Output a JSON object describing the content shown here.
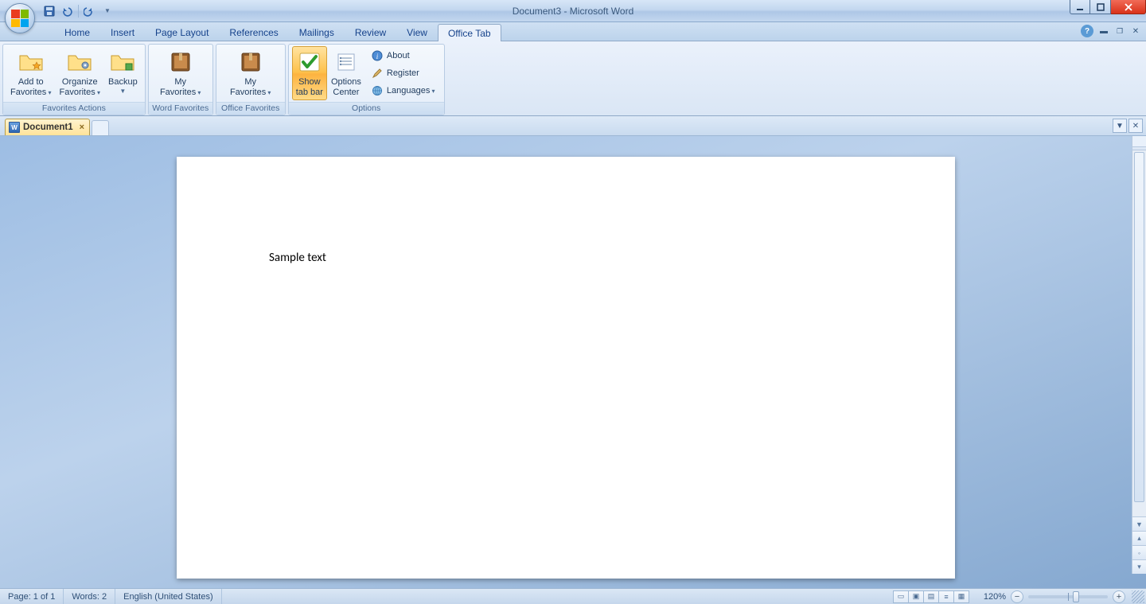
{
  "app_title": "Document3 - Microsoft Word",
  "ribbon_tabs": [
    "Home",
    "Insert",
    "Page Layout",
    "References",
    "Mailings",
    "Review",
    "View",
    "Office Tab"
  ],
  "active_ribbon_tab": "Office Tab",
  "groups": {
    "favorites_actions": {
      "label": "Favorites Actions",
      "add_to_favorites": "Add to\nFavorites",
      "organize_favorites": "Organize\nFavorites",
      "backup": "Backup"
    },
    "word_favorites": {
      "label": "Word Favorites",
      "my_favorites": "My\nFavorites"
    },
    "office_favorites": {
      "label": "Office Favorites",
      "my_favorites": "My\nFavorites"
    },
    "options": {
      "label": "Options",
      "show_tab_bar": "Show\ntab bar",
      "options_center": "Options\nCenter",
      "about": "About",
      "register": "Register",
      "languages": "Languages"
    }
  },
  "doc_tabs": {
    "active": "Document1"
  },
  "document": {
    "body_text": "Sample text"
  },
  "status": {
    "page": "Page: 1 of 1",
    "words": "Words: 2",
    "language": "English (United States)",
    "zoom": "120%"
  }
}
